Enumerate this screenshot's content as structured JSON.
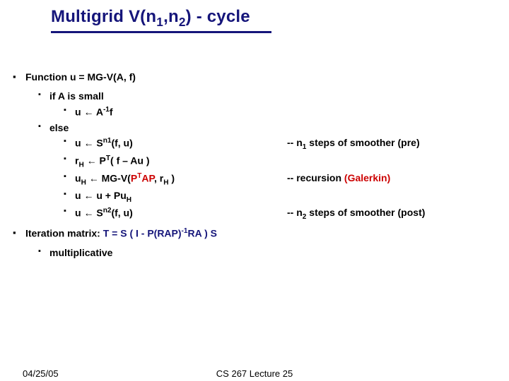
{
  "title": {
    "pre": "Multigrid V(",
    "n1": "n",
    "sub1": "1",
    "comma": ",",
    "n2": "n",
    "sub2": "2",
    "post": ") - cycle"
  },
  "bullet1": "Function u = MG-V(A, f)",
  "ifline": "if A is small",
  "step0": {
    "u": "u ",
    "arrow": "←",
    "rest": " A",
    "sup": "-1",
    "tail": "f"
  },
  "elseL": "else",
  "step1": {
    "left_a": "u ",
    "arrow": "←",
    "sprefix": " S",
    "n": "n",
    "one": "1",
    "tail": "(f, u)",
    "right_pre": "-- ",
    "right_n": "n",
    "right_one": "1",
    "right_post": " steps of smoother (pre)"
  },
  "step2": {
    "r": "r",
    "H": "H",
    "arrow": " ← ",
    "P": "P",
    "T": "T",
    "rest": "( f – Au )"
  },
  "step3": {
    "u": "u",
    "H1": "H",
    "arrow": " ← ",
    "mg": "MG-V(",
    "P1": "P",
    "T": "T",
    "A": "A",
    "P2": "P",
    "comma": ", ",
    "r": "r",
    "H2": "H",
    "close": " )",
    "right_pre": "-- recursion ",
    "right_gal": "(Galerkin)"
  },
  "step4": {
    "u1": "u ",
    "arrow": "←",
    "rest_a": " u + Pu",
    "H": "H"
  },
  "step5": {
    "u": "u ",
    "arrow": "←",
    "sprefix": " S",
    "n": "n",
    "two": "2",
    "tail": "(f, u)",
    "right_pre": "-- ",
    "right_n": "n",
    "right_two": "2",
    "right_post": " steps of smoother (post)"
  },
  "bullet2": {
    "pre": "Iteration matrix: ",
    "mid": "T = S ( I - P(RAP)",
    "sup": "-1",
    "post": "RA ) S"
  },
  "mult": "multiplicative",
  "footer": {
    "date": "04/25/05",
    "center": "CS 267 Lecture 25"
  }
}
